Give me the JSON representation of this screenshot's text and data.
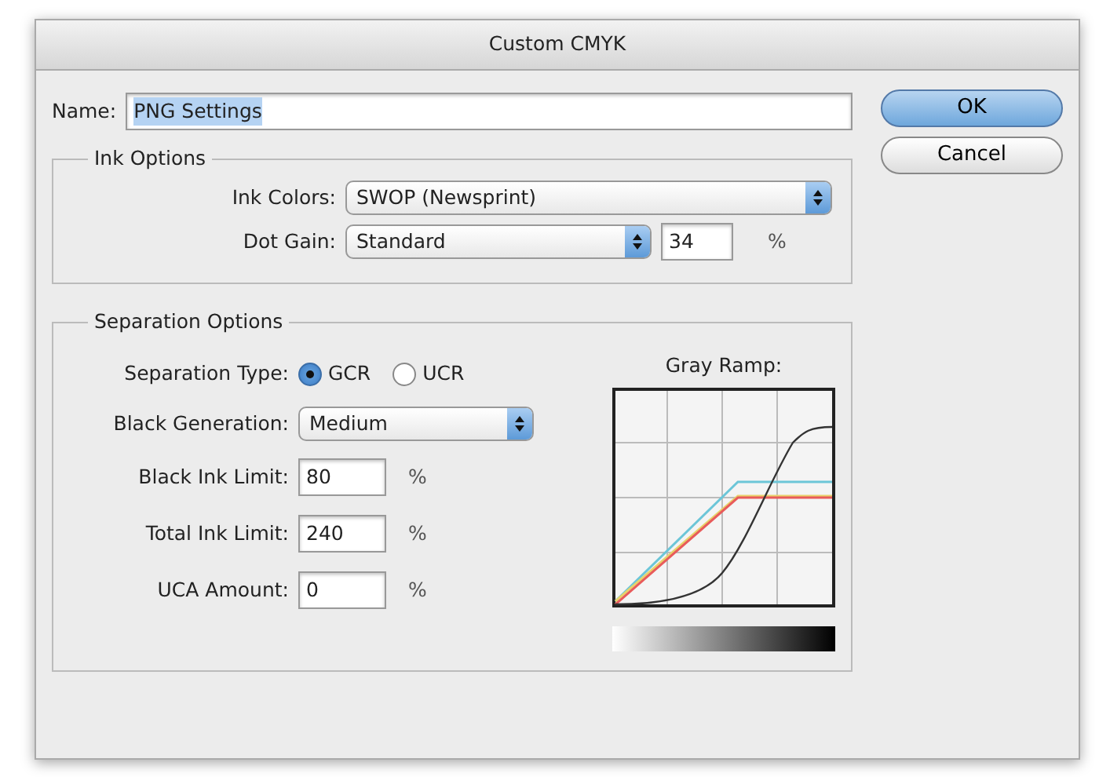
{
  "window": {
    "title": "Custom CMYK"
  },
  "name_field": {
    "label": "Name:",
    "value": "PNG Settings",
    "value_selected": true
  },
  "buttons": [
    {
      "label": "OK",
      "default": true
    },
    {
      "label": "Cancel",
      "default": false
    }
  ],
  "ink_options": {
    "title": "Ink Options",
    "ink_colors": {
      "label": "Ink Colors:",
      "value": "SWOP (Newsprint)"
    },
    "dot_gain": {
      "label": "Dot Gain:",
      "value": "Standard",
      "amount": "34",
      "unit": "%"
    }
  },
  "separation_options": {
    "title": "Separation Options",
    "separation_type": {
      "label": "Separation Type:",
      "options": [
        {
          "label": "GCR",
          "selected": true
        },
        {
          "label": "UCR",
          "selected": false
        }
      ]
    },
    "black_generation": {
      "label": "Black Generation:",
      "value": "Medium"
    },
    "limits": [
      {
        "label": "Black Ink Limit:",
        "value": "80",
        "unit": "%"
      },
      {
        "label": "Total Ink Limit:",
        "value": "240",
        "unit": "%"
      },
      {
        "label": "UCA Amount:",
        "value": "0",
        "unit": "%"
      }
    ],
    "gray_ramp": {
      "label": "Gray Ramp:"
    }
  }
}
